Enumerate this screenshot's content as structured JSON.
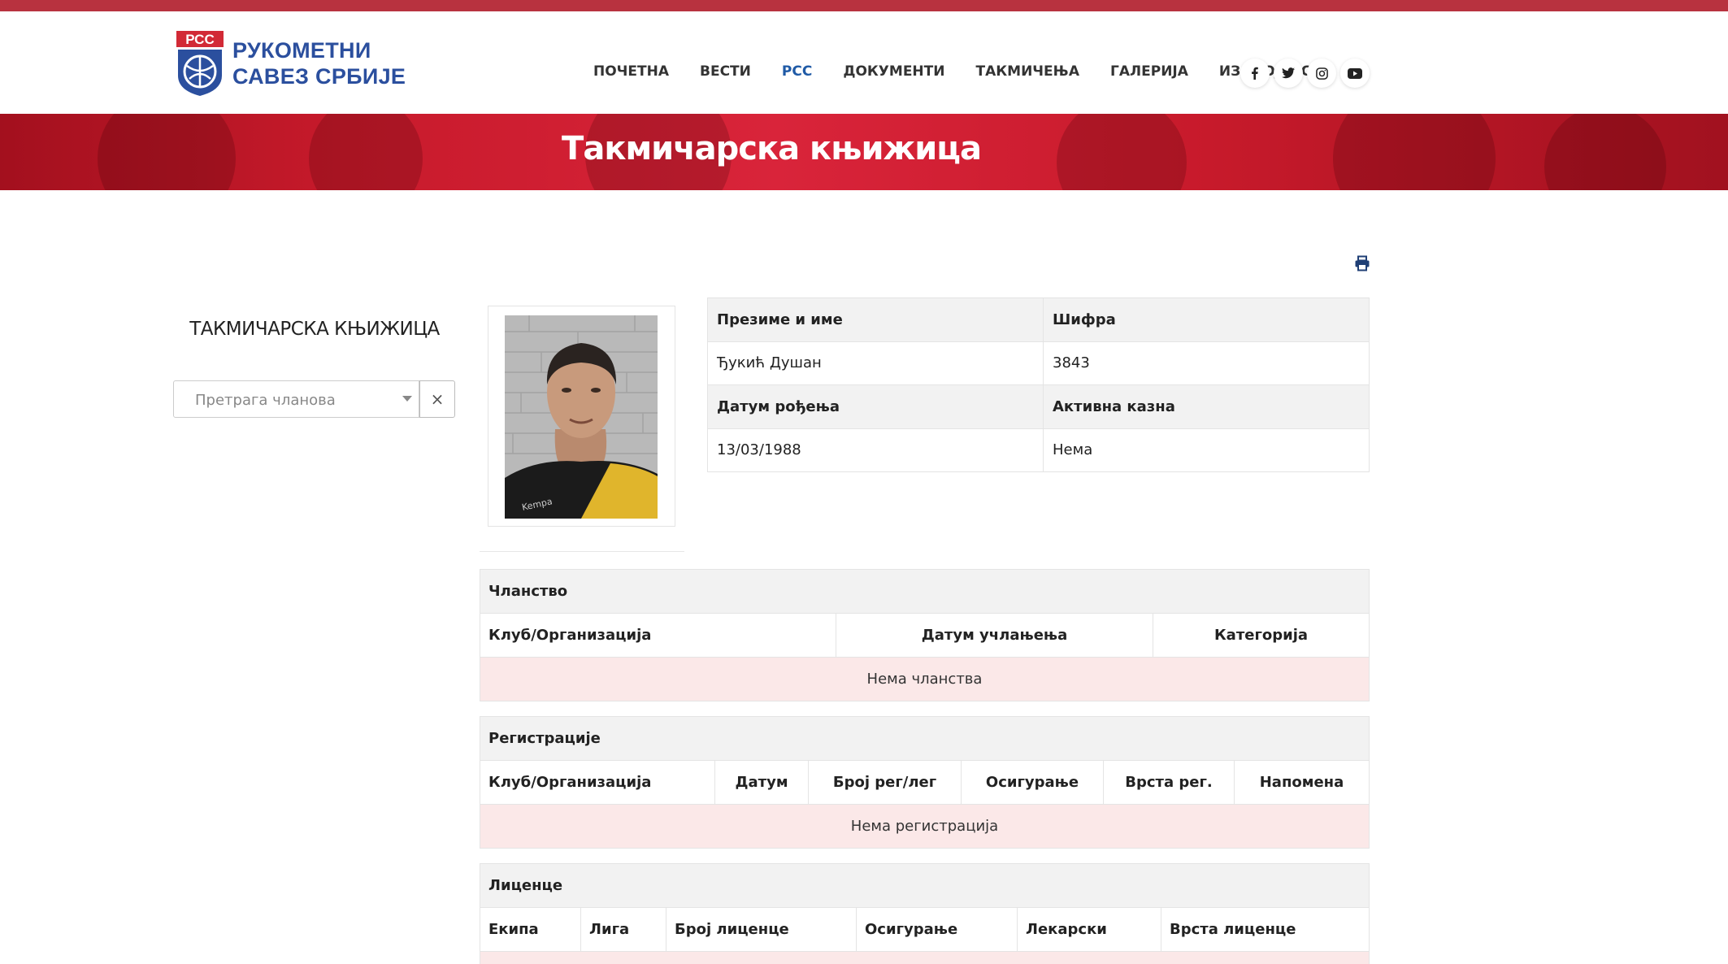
{
  "brand": {
    "badge_text": "РСС",
    "line1": "РУКОМЕТНИ",
    "line2": "САВЕЗ СРБИЈЕ",
    "primary_color": "#2b4f9e",
    "accent_color": "#c71a2b"
  },
  "nav": {
    "items": [
      {
        "label": "ПОЧЕТНА"
      },
      {
        "label": "ВЕСТИ"
      },
      {
        "label": "РСС",
        "active": true
      },
      {
        "label": "ДОКУМЕНТИ"
      },
      {
        "label": "ТАКМИЧЕЊА"
      },
      {
        "label": "ГАЛЕРИЈА"
      },
      {
        "label": "ИЗДВОЈЕНО"
      }
    ],
    "social": [
      "facebook-icon",
      "twitter-icon",
      "instagram-icon",
      "youtube-icon"
    ]
  },
  "banner": {
    "title": "Такмичарска књижица"
  },
  "sidebar": {
    "title": "ТАКМИЧАРСКА КЊИЖИЦА",
    "search_placeholder": "Претрага чланова",
    "clear_label": "×"
  },
  "player": {
    "name_label": "Презиме и име",
    "name": "Ђукић Душан",
    "code_label": "Шифра",
    "code": "3843",
    "dob_label": "Датум рођења",
    "dob": "13/03/1988",
    "ban_label": "Активна казна",
    "ban": "Нема"
  },
  "membership": {
    "title": "Чланство",
    "columns": [
      "Клуб/Организација",
      "Датум учлањења",
      "Категорија"
    ],
    "empty": "Нема чланства"
  },
  "registrations": {
    "title": "Регистрације",
    "columns": [
      "Клуб/Организација",
      "Датум",
      "Број рег/лег",
      "Осигурање",
      "Врста рег.",
      "Напомена"
    ],
    "empty": "Нема регистрација"
  },
  "licenses": {
    "title": "Лиценце",
    "columns": [
      "Екипа",
      "Лига",
      "Број лиценце",
      "Осигурање",
      "Лекарски",
      "Врста лиценце"
    ]
  }
}
